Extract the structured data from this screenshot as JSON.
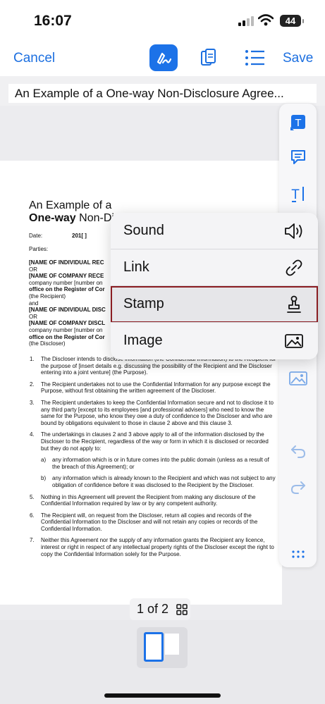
{
  "status": {
    "time": "16:07",
    "battery": "44"
  },
  "toolbar": {
    "cancel_label": "Cancel",
    "save_label": "Save"
  },
  "document": {
    "title": "An Example of a One-way Non-Disclosure Agree...",
    "heading_line1": "An Example of a",
    "heading_line2_bold": "One-way",
    "heading_line2_rest": " Non-Di",
    "date_label": "Date:",
    "date_value": "201[ ]",
    "parties_label": "Parties:",
    "parties": [
      "[NAME OF INDIVIDUAL REC",
      "OR",
      "[NAME OF COMPANY RECE",
      "company number [number on",
      "office on the Register of Cor",
      "(the Recipient)",
      "and",
      "[NAME OF INDIVIDUAL DISC",
      "OR",
      "[NAME OF COMPANY DISCL",
      "company number [number on",
      "office on the Register of Cor",
      "(the Discloser)"
    ],
    "clauses": [
      {
        "num": "1.",
        "text": "The Discloser intends to disclose information (the Confidential Information) to the Recipient for the purpose of [insert details e.g. discussing the possibility of the Recipient and the Discloser entering into a joint venture] (the Purpose).",
        "sub": false
      },
      {
        "num": "2.",
        "text": "The Recipient undertakes not to use the Confidential Information for any purpose except the Purpose, without first obtaining the written agreement of the Discloser.",
        "sub": false
      },
      {
        "num": "3.",
        "text": "The Recipient undertakes to keep the Confidential Information secure and not to disclose it to any third party [except to its employees [and professional advisers] who need to know the same for the Purpose, who know they owe a duty of confidence to the Discloser and who are bound by obligations equivalent to those in clause 2 above and this clause 3.",
        "sub": false
      },
      {
        "num": "4.",
        "text": "The undertakings in clauses 2 and 3 above apply to all of the information disclosed by the Discloser to the Recipient, regardless of the way or form in which it is disclosed or recorded but they do not apply to:",
        "sub": false
      },
      {
        "num": "a)",
        "text": "any information which is or in future comes into the public domain (unless as a result of the breach of this Agreement); or",
        "sub": true
      },
      {
        "num": "b)",
        "text": "any information which is already known to the Recipient and which was not subject to any obligation of confidence before it was disclosed to the Recipient by the Discloser.",
        "sub": true
      },
      {
        "num": "5.",
        "text": "Nothing in this Agreement will prevent the Recipient from making any disclosure of the Confidential Information required by law or by any competent authority.",
        "sub": false
      },
      {
        "num": "6.",
        "text": "The Recipient will, on request from the Discloser, return all copies and records of the Confidential Information to the Discloser and will not retain any copies or records of the Confidential Information.",
        "sub": false
      },
      {
        "num": "7.",
        "text": "Neither this Agreement nor the supply of any information grants the Recipient any licence, interest or right in respect of any intellectual property rights of the Discloser except the right to copy the Confidential Information solely for the Purpose.",
        "sub": false
      }
    ]
  },
  "insert_menu": {
    "items": [
      {
        "label": "Sound",
        "icon": "speaker-icon"
      },
      {
        "label": "Link",
        "icon": "link-icon"
      },
      {
        "label": "Stamp",
        "icon": "stamp-icon",
        "selected": true
      },
      {
        "label": "Image",
        "icon": "image-icon"
      }
    ]
  },
  "rail_tools": [
    "text-box-icon",
    "comment-icon",
    "text-cursor-icon",
    "image-insert-icon",
    "undo-icon",
    "redo-icon",
    "more-icon"
  ],
  "pager": {
    "label": "1 of 2"
  },
  "colors": {
    "accent": "#1c72e8",
    "selection_outline": "#8a1d22"
  }
}
